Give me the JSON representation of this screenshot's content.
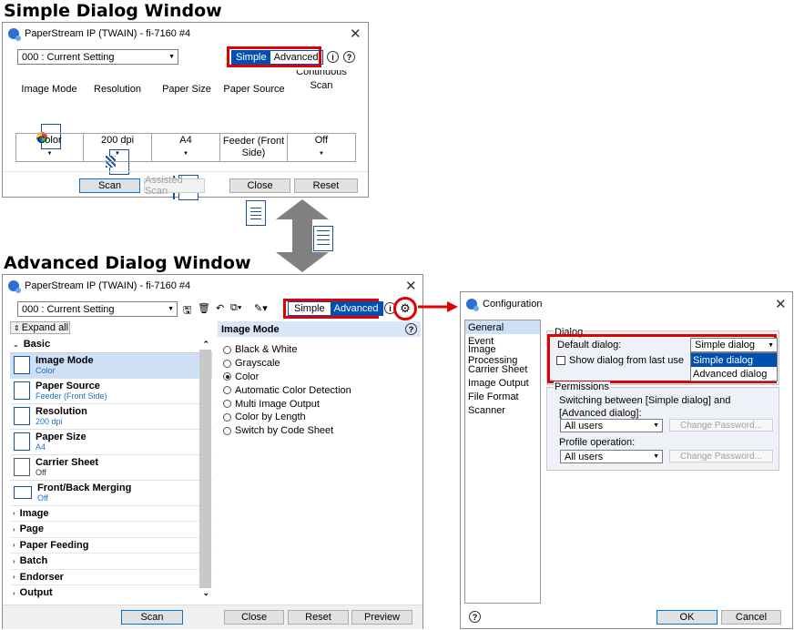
{
  "simple": {
    "heading": "Simple Dialog Window",
    "title": "PaperStream IP (TWAIN) - fi-7160 #4",
    "setting": "000 : Current Setting",
    "mode_simple": "Simple",
    "mode_advanced": "Advanced",
    "columns": [
      {
        "label": "Image Mode",
        "value": "Color"
      },
      {
        "label": "Resolution",
        "value": "200 dpi"
      },
      {
        "label": "Paper Size",
        "value": "A4"
      },
      {
        "label": "Paper Source",
        "value": "Feeder (Front Side)"
      },
      {
        "label": "Continuous Scan",
        "value": "Off"
      }
    ],
    "buttons": {
      "scan": "Scan",
      "assisted": "Assisted Scan",
      "close": "Close",
      "reset": "Reset"
    }
  },
  "advanced": {
    "heading": "Advanced Dialog Window",
    "title": "PaperStream IP (TWAIN) - fi-7160 #4",
    "setting": "000 : Current Setting",
    "mode_simple": "Simple",
    "mode_advanced": "Advanced",
    "expand_all": "Expand all",
    "basic": "Basic",
    "items": [
      {
        "title": "Image Mode",
        "value": "Color",
        "icon": "image-mode-icon"
      },
      {
        "title": "Paper Source",
        "value": "Feeder (Front Side)",
        "icon": "paper-source-icon"
      },
      {
        "title": "Resolution",
        "value": "200 dpi",
        "icon": "resolution-icon"
      },
      {
        "title": "Paper Size",
        "value": "A4",
        "icon": "paper-size-icon"
      },
      {
        "title": "Carrier Sheet",
        "value": "Off",
        "icon": "carrier-sheet-icon"
      },
      {
        "title": "Front/Back Merging",
        "value": "Off",
        "icon": "merging-icon"
      }
    ],
    "categories": [
      "Image",
      "Page",
      "Paper Feeding",
      "Batch",
      "Endorser",
      "Output"
    ],
    "panel_title": "Image Mode",
    "options": [
      "Black & White",
      "Grayscale",
      "Color",
      "Automatic Color Detection",
      "Multi Image Output",
      "Color by Length",
      "Switch by Code Sheet"
    ],
    "selected_option": "Color",
    "buttons": {
      "scan": "Scan",
      "close": "Close",
      "reset": "Reset",
      "preview": "Preview"
    }
  },
  "config": {
    "title": "Configuration",
    "nav": [
      "General",
      "Event",
      "Image Processing",
      "Carrier Sheet",
      "Image Output",
      "File Format",
      "Scanner"
    ],
    "dialog_group": "Dialog",
    "default_label": "Default dialog:",
    "default_value": "Simple dialog",
    "dropdown_options": [
      "Simple dialog",
      "Advanced dialog"
    ],
    "checkbox_label": "Show dialog from last use",
    "permissions_group": "Permissions",
    "switching_text": "Switching between [Simple dialog] and [Advanced dialog]:",
    "all_users": "All users",
    "change_password": "Change Password...",
    "profile_label": "Profile operation:",
    "ok": "OK",
    "cancel": "Cancel"
  },
  "colors": {
    "accent": "#0050b3",
    "highlight": "#e00000",
    "arrow": "#808080"
  }
}
